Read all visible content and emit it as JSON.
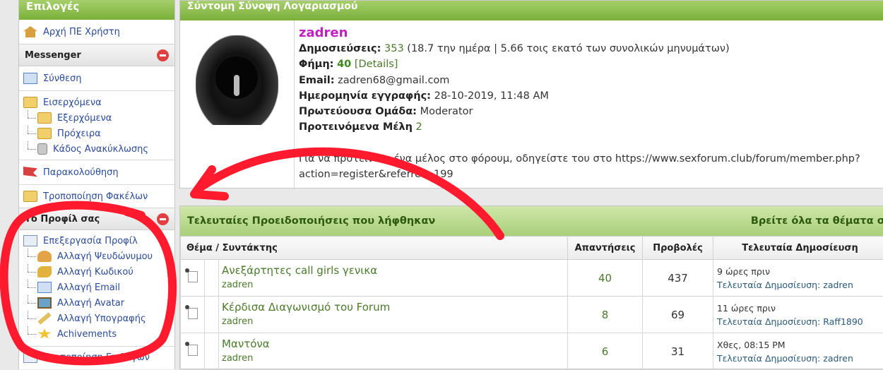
{
  "left": {
    "title": "Επιλογές",
    "home": "Αρχή ΠΕ Χρήστη",
    "messenger": {
      "title": "Messenger",
      "compose": "Σύνθεση",
      "inbox": "Εισερχόμενα",
      "outbox": "Εξερχόμενα",
      "drafts": "Πρόχειρα",
      "trash": "Κάδος Ανακύκλωσης",
      "track": "Παρακολούθηση",
      "edit_folders": "Τροποποίηση Φακέλων"
    },
    "profile": {
      "title": "Το Προφίλ σας",
      "edit_profile": "Επεξεργασία Προφίλ",
      "change_nick": "Αλλαγή Ψευδώνυμου",
      "change_pass": "Αλλαγή Κωδικού",
      "change_email": "Αλλαγή Email",
      "change_avatar": "Αλλαγή Avatar",
      "change_sig": "Αλλαγή Υπογραφής",
      "achievements": "Achivements",
      "edit_options": "Τροποποίηση Επιλογών"
    }
  },
  "summary": {
    "title": "Σύντομη Σύνοψη Λογαριασμού",
    "username": "zadren",
    "posts_label": "Δημοσιεύσεις:",
    "posts_value": "353",
    "posts_extra": " (18.7 την ημέρα | 5.66 τοις εκατό των συνολικών μηνυμάτων)",
    "rep_label": "Φήμη:",
    "rep_value": "40",
    "rep_details": "[Details]",
    "email_label": "Email:",
    "email_value": "zadren68@gmail.com",
    "reg_label": "Ημερομηνία εγγραφής:",
    "reg_value": "28-10-2019, 11:48 AM",
    "group_label": "Πρωτεύουσα Ομάδα:",
    "group_value": "Moderator",
    "referred_label": "Προτεινόμενα Μέλη",
    "referred_value": "2",
    "referral_text": "Για να προτείνετε ένα μέλος στο φόρουμ, οδηγείστε του στο https://www.sexforum.club/forum/member.php?",
    "referral_text2": "action=register&referrer=199"
  },
  "threads": {
    "title": "Τελευταίες Προειδοποιήσεις που λήφθηκαν",
    "find_all": "Βρείτε όλα τα θέματα σ",
    "col_topic": "Θέμα / Συντάκτης",
    "col_replies": "Απαντήσεις",
    "col_views": "Προβολές",
    "col_last": "Τελευταία Δημοσίευση",
    "rows": [
      {
        "title": "Ανεξάρτητες call girls γενικα",
        "author": "zadren",
        "replies": "40",
        "views": "437",
        "time": "9 ώρες πριν",
        "last_label": "Τελευταία Δημοσίευση:",
        "last_by": "zadren"
      },
      {
        "title": "Κέρδισα Διαγωνισμό του Forum",
        "author": "zadren",
        "replies": "8",
        "views": "69",
        "time": "11 ώρες πριν",
        "last_label": "Τελευταία Δημοσίευση:",
        "last_by": "Raff1890"
      },
      {
        "title": "Μαντόνα",
        "author": "zadren",
        "replies": "6",
        "views": "31",
        "time": "Χθες, 08:15 PM",
        "last_label": "Τελευταία Δημοσίευση:",
        "last_by": "zadren"
      }
    ]
  },
  "colors": {
    "accent_green": "#7ab03a",
    "link_green": "#4a7a2a",
    "username_magenta": "#c020c0",
    "annotation_red": "#ff1a2e"
  }
}
